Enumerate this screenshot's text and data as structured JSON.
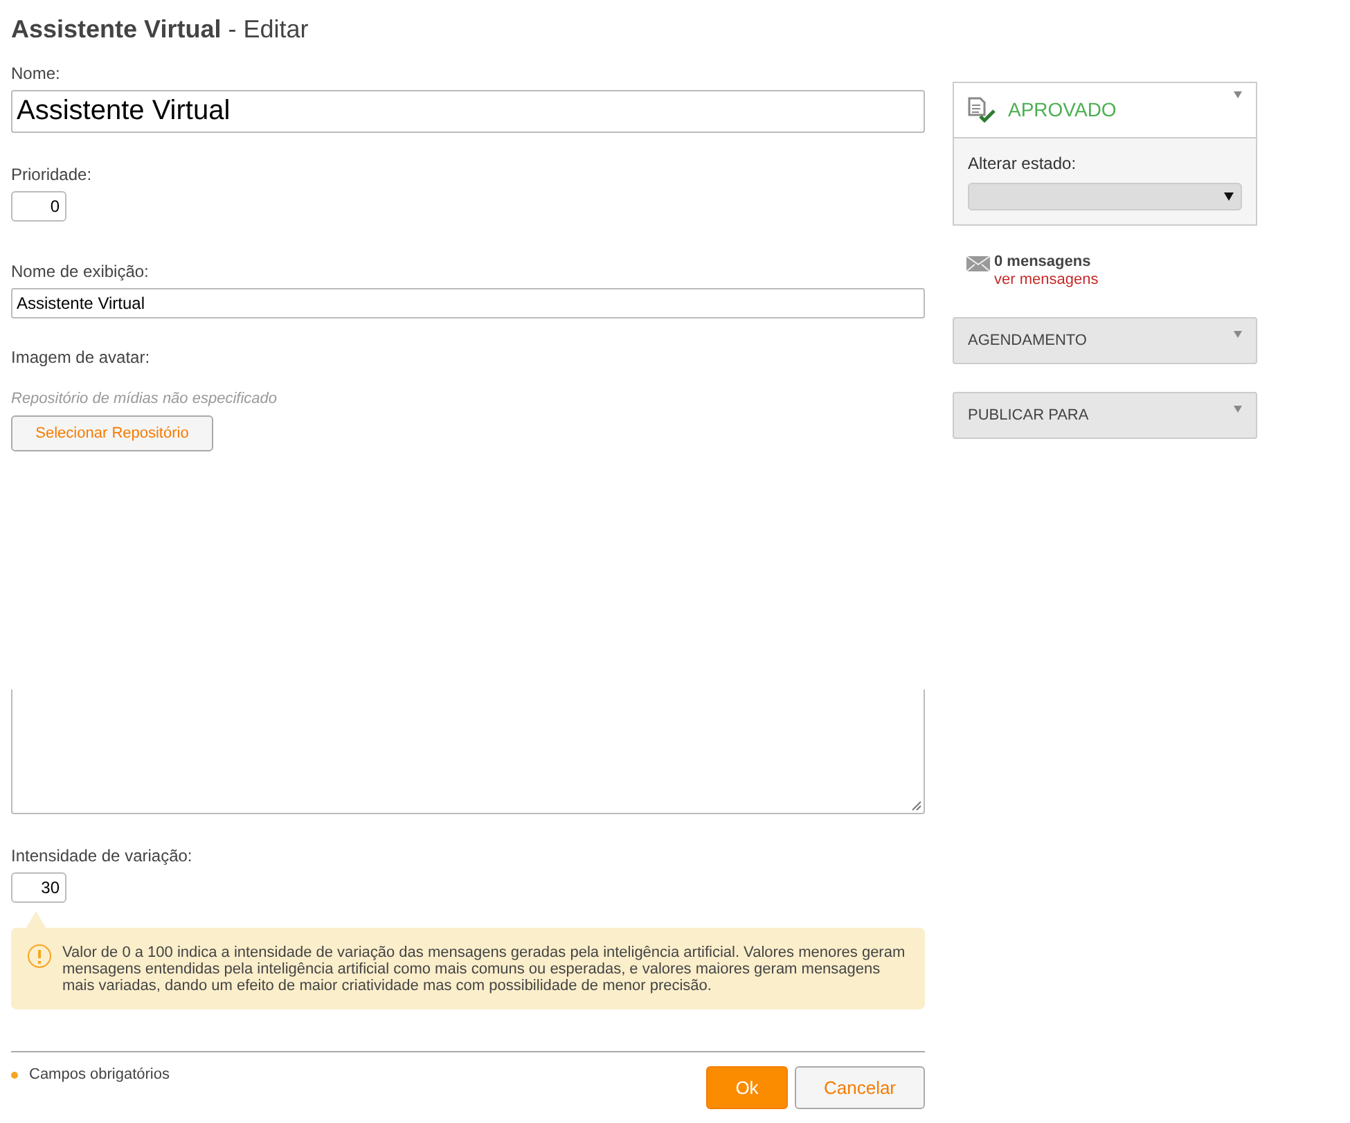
{
  "title": "**Assistente Virtual** - Editar",
  "fields": [
    {
      "kind": "large_text",
      "label": "Nome:",
      "value": "Assistente Virtual"
    },
    {
      "kind": "number",
      "label": "Prioridade:",
      "value": "0"
    },
    {
      "kind": "text",
      "label": "Nome de exibição:",
      "value": "Assistente Virtual"
    },
    {
      "kind": "media",
      "label": "Imagem de avatar:",
      "note": "Repositório de mídias não especificado",
      "button": "Selecionar Repositório"
    },
    {
      "kind": "textarea"
    },
    {
      "kind": "number",
      "label": "Intensidade de variação:",
      "value": "30",
      "hint": "Valor de 0 a 100 indica a intensidade de variação das mensagens geradas pela inteligência artificial. Valores menores geram mensagens entendidas pela inteligência artificial como mais comuns ou esperadas, e valores maiores geram mensagens mais variadas, dando um efeito de maior criatividade mas com possibilidade de menor precisão."
    }
  ],
  "required_note": "Campos obrigatórios",
  "buttons": [
    {
      "label": "Ok",
      "kind": "primary"
    },
    {
      "label": "Cancelar",
      "kind": "secondary"
    }
  ],
  "status": {
    "label": "APROVADO",
    "change_label": "Alterar estado:"
  },
  "messages": {
    "count": "0 mensagens",
    "link": "ver mensagens"
  },
  "panels": [
    {
      "label": "AGENDAMENTO",
      "expanded": false
    },
    {
      "label": "PUBLICAR PARA",
      "expanded": false
    }
  ]
}
